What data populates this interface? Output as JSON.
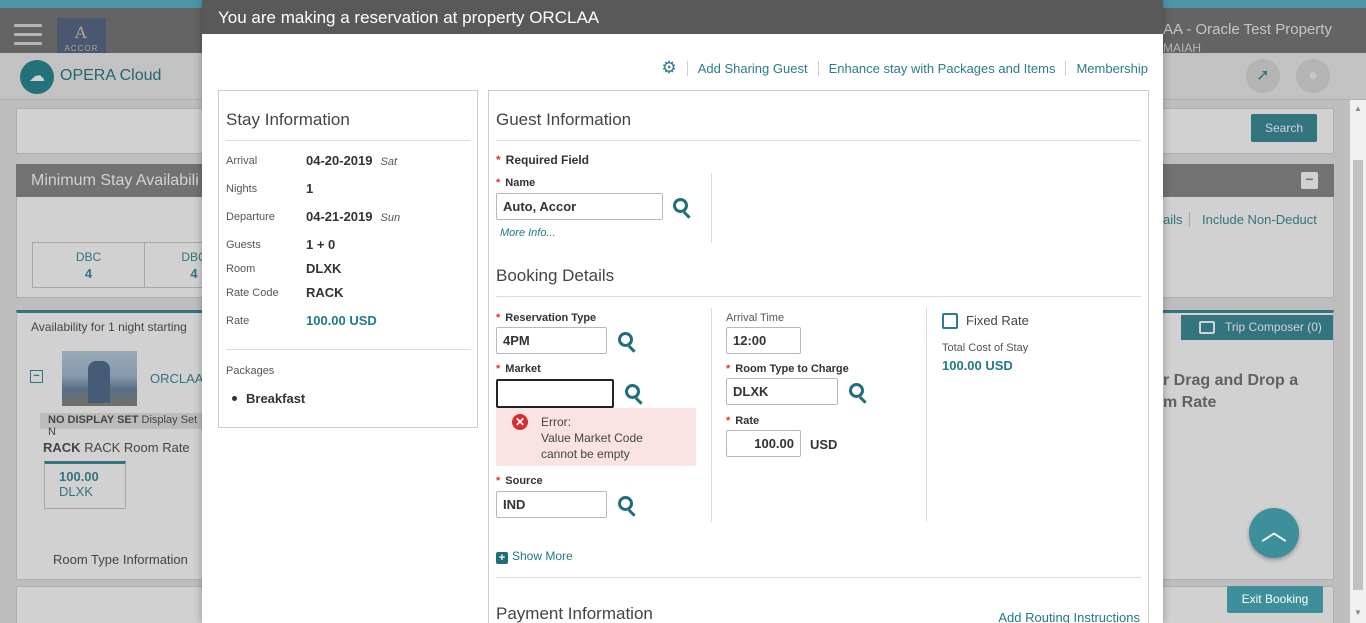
{
  "background": {
    "brand_logo_text": "ACCOR",
    "brand_logo_mark": "A",
    "property_title": "AA - Oracle Test Property",
    "property_sub": "MAIAH",
    "app_name": "OPERA Cloud",
    "search_button": "Search",
    "min_stay_heading": "Minimum Stay Availabili",
    "dbc_cells": [
      {
        "label": "DBC",
        "value": "4"
      },
      {
        "label": "DBC",
        "value": "4"
      }
    ],
    "link_details_partial": "ails",
    "link_include_non_deduct": "Include Non-Deduct",
    "availability_text": "Availability for 1 night starting",
    "trip_composer": "Trip Composer (0)",
    "drag_text_line1": "r Drag and Drop a",
    "drag_text_line2": "m Rate",
    "property_code": "ORCLAA",
    "no_display_set": "NO DISPLAY SET",
    "display_set_partial": "Display Set N",
    "rack_code": "RACK",
    "rack_desc": "RACK Room Rate",
    "rate_cell_value": "100.00",
    "rate_cell_room": "DLXK",
    "room_type_info": "Room Type Information",
    "exit_booking": "Exit Booking"
  },
  "modal": {
    "title": "You are making a reservation at property ORCLAA",
    "links": [
      "Add Sharing Guest",
      "Enhance stay with Packages and Items",
      "Membership"
    ]
  },
  "stay": {
    "heading": "Stay Information",
    "arrival_label": "Arrival",
    "arrival_value": "04-20-2019",
    "arrival_day": "Sat",
    "nights_label": "Nights",
    "nights_value": "1",
    "departure_label": "Departure",
    "departure_value": "04-21-2019",
    "departure_day": "Sun",
    "guests_label": "Guests",
    "guests_value": "1 + 0",
    "room_label": "Room",
    "room_value": "DLXK",
    "ratecode_label": "Rate Code",
    "ratecode_value": "RACK",
    "rate_label": "Rate",
    "rate_value": "100.00 USD",
    "packages_label": "Packages",
    "packages": [
      "Breakfast"
    ]
  },
  "guest": {
    "heading": "Guest Information",
    "required_field": "Required Field",
    "name_label": "Name",
    "name_value": "Auto, Accor",
    "more_info": "More Info..."
  },
  "booking": {
    "heading": "Booking Details",
    "reservation_type_label": "Reservation Type",
    "reservation_type_value": "4PM",
    "market_label": "Market",
    "market_value": "",
    "error_title": "Error:",
    "error_line1": "Value Market Code",
    "error_line2": "cannot be empty",
    "source_label": "Source",
    "source_value": "IND",
    "arrival_time_label": "Arrival Time",
    "arrival_time_value": "12:00",
    "room_type_charge_label": "Room Type to Charge",
    "room_type_charge_value": "DLXK",
    "rate_label": "Rate",
    "rate_value": "100.00",
    "rate_currency": "USD",
    "fixed_rate_label": "Fixed Rate",
    "fixed_rate_checked": false,
    "total_cost_label": "Total Cost of Stay",
    "total_cost_value": "100.00 USD",
    "show_more": "Show More"
  },
  "payment": {
    "heading": "Payment Information",
    "add_routing": "Add Routing Instructions"
  },
  "colors": {
    "accent": "#1f7a87",
    "button": "#3d8f9c",
    "error_bg": "#fbe3e3",
    "error_icon": "#d32f2f",
    "modal_header": "#595959"
  }
}
